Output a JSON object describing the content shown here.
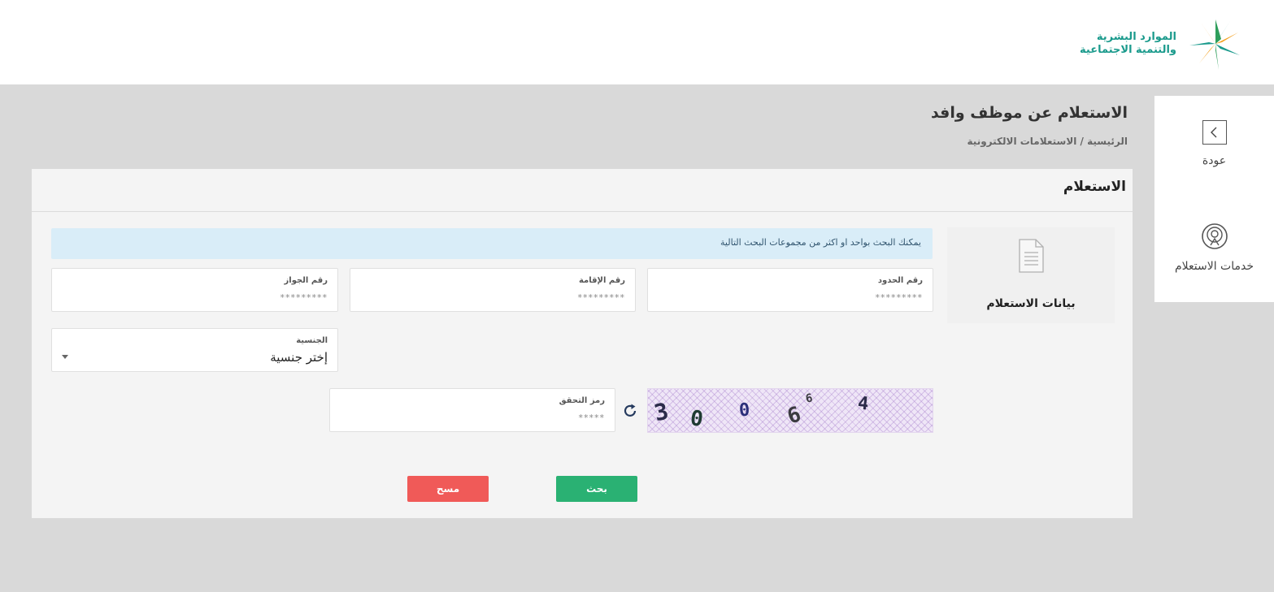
{
  "brand": {
    "name_line1": "الموارد البشرية",
    "name_line2": "والتنمية الاجتماعية",
    "colors": {
      "teal": "#1a9a8c",
      "orange": "#f4a11f",
      "green": "#2e9e5b"
    }
  },
  "sidebar": {
    "back_label": "عودة",
    "services_label": "خدمات الاستعلام"
  },
  "header": {
    "title": "الاستعلام عن موظف وافد",
    "breadcrumb": "الرئيسية / الاستعلامات الالكترونية"
  },
  "card": {
    "title": "الاستعلام",
    "info_label": "بيانات الاستعلام",
    "alert": "يمكنك البحث بواحد او اكثر من مجموعات البحث التالية"
  },
  "fields": {
    "border_number": {
      "label": "رقم الحدود",
      "placeholder": "*********"
    },
    "iqama_number": {
      "label": "رقم الإقامة",
      "placeholder": "*********"
    },
    "passport_number": {
      "label": "رقم الجواز",
      "placeholder": "*********"
    },
    "nationality": {
      "label": "الجنسية",
      "selected": "إختر جنسية"
    },
    "captcha_code": {
      "label": "رمز التحقق",
      "placeholder": "*****"
    }
  },
  "captcha_image": {
    "chars": [
      "3",
      "0",
      "0",
      "6",
      "6",
      "4"
    ]
  },
  "buttons": {
    "search": "بحث",
    "clear": "مسح",
    "colors": {
      "search": "#2ab173",
      "clear": "#f05a58"
    }
  }
}
